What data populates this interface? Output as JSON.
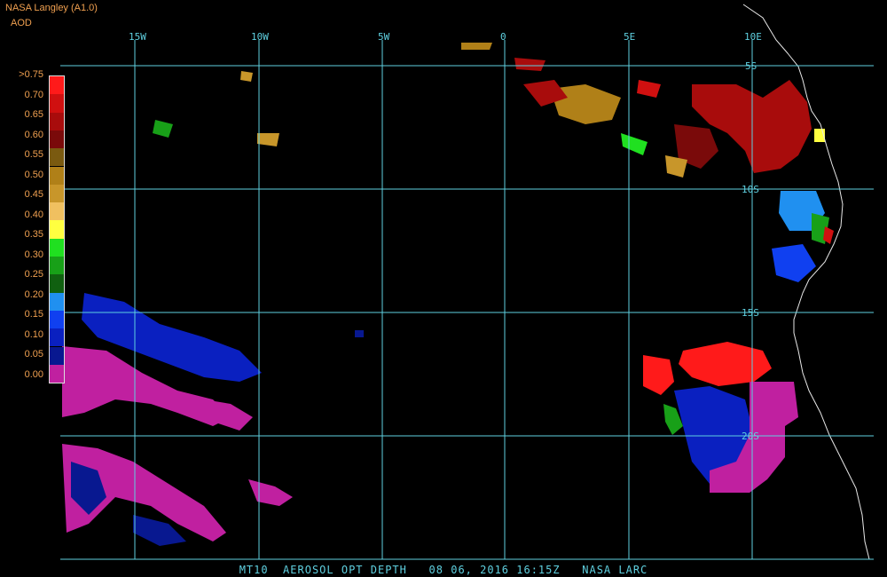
{
  "header": {
    "title": "NASA Langley (A1.0)",
    "product": "AOD"
  },
  "legend": {
    "labels": [
      ">0.75",
      "0.70",
      "0.65",
      "0.60",
      "0.55",
      "0.50",
      "0.45",
      "0.40",
      "0.35",
      "0.30",
      "0.25",
      "0.20",
      "0.15",
      "0.10",
      "0.05",
      "0.00"
    ],
    "colors": [
      "#ff1a1a",
      "#d01010",
      "#a80c0c",
      "#7a0a0a",
      "#7a5a10",
      "#b08018",
      "#c8962a",
      "#f0c060",
      "#ffff40",
      "#20e020",
      "#18a018",
      "#106010",
      "#2090f0",
      "#1040f0",
      "#0a20c0",
      "#081890",
      "#c020a0"
    ]
  },
  "map": {
    "longitude_labels": [
      "15W",
      "10W",
      "5W",
      "0",
      "5E",
      "10E"
    ],
    "latitude_labels": [
      "5S",
      "10S",
      "15S",
      "20S"
    ]
  },
  "footer": {
    "text": "MT10  AEROSOL OPT DEPTH   08 06, 2016 16:15Z   NASA LARC"
  }
}
